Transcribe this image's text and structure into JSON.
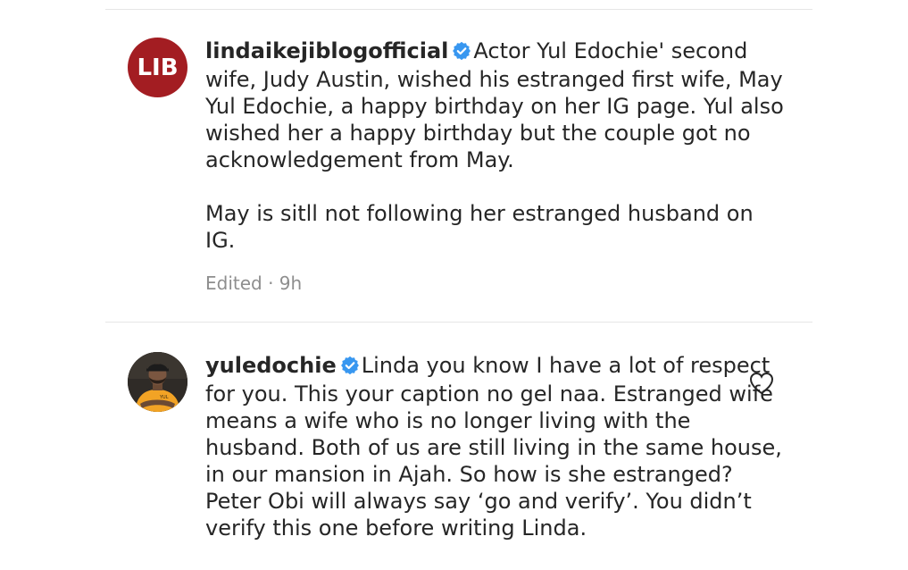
{
  "comments": [
    {
      "username": "lindaikejiblogofficial",
      "avatar_text": "LIB",
      "verified": true,
      "paragraphs": [
        "Actor Yul Edochie' second wife, Judy Austin, wished his estranged first wife, May Yul Edochie, a happy birthday on her IG page. Yul also wished her a happy birthday but the couple got no acknowledgement from May.",
        "May is sitll not following her estranged husband on IG."
      ],
      "meta": "Edited · 9h"
    },
    {
      "username": "yuledochie",
      "verified": true,
      "text": "Linda you know I have a lot of respect for you. This your caption no gel naa. Estranged wife means a wife who is no longer living with the husband. Both of us are still living in the same house, in our mansion in Ajah. So how is she estranged? Peter Obi will always say ‘go and verify’. You didn’t verify this one before writing Linda."
    }
  ],
  "colors": {
    "verified_badge": "#3897f0",
    "lib_avatar_bg": "#a31d22",
    "meta_text": "#8e8e8e"
  },
  "icons": [
    "verified-badge-icon",
    "heart-icon"
  ]
}
